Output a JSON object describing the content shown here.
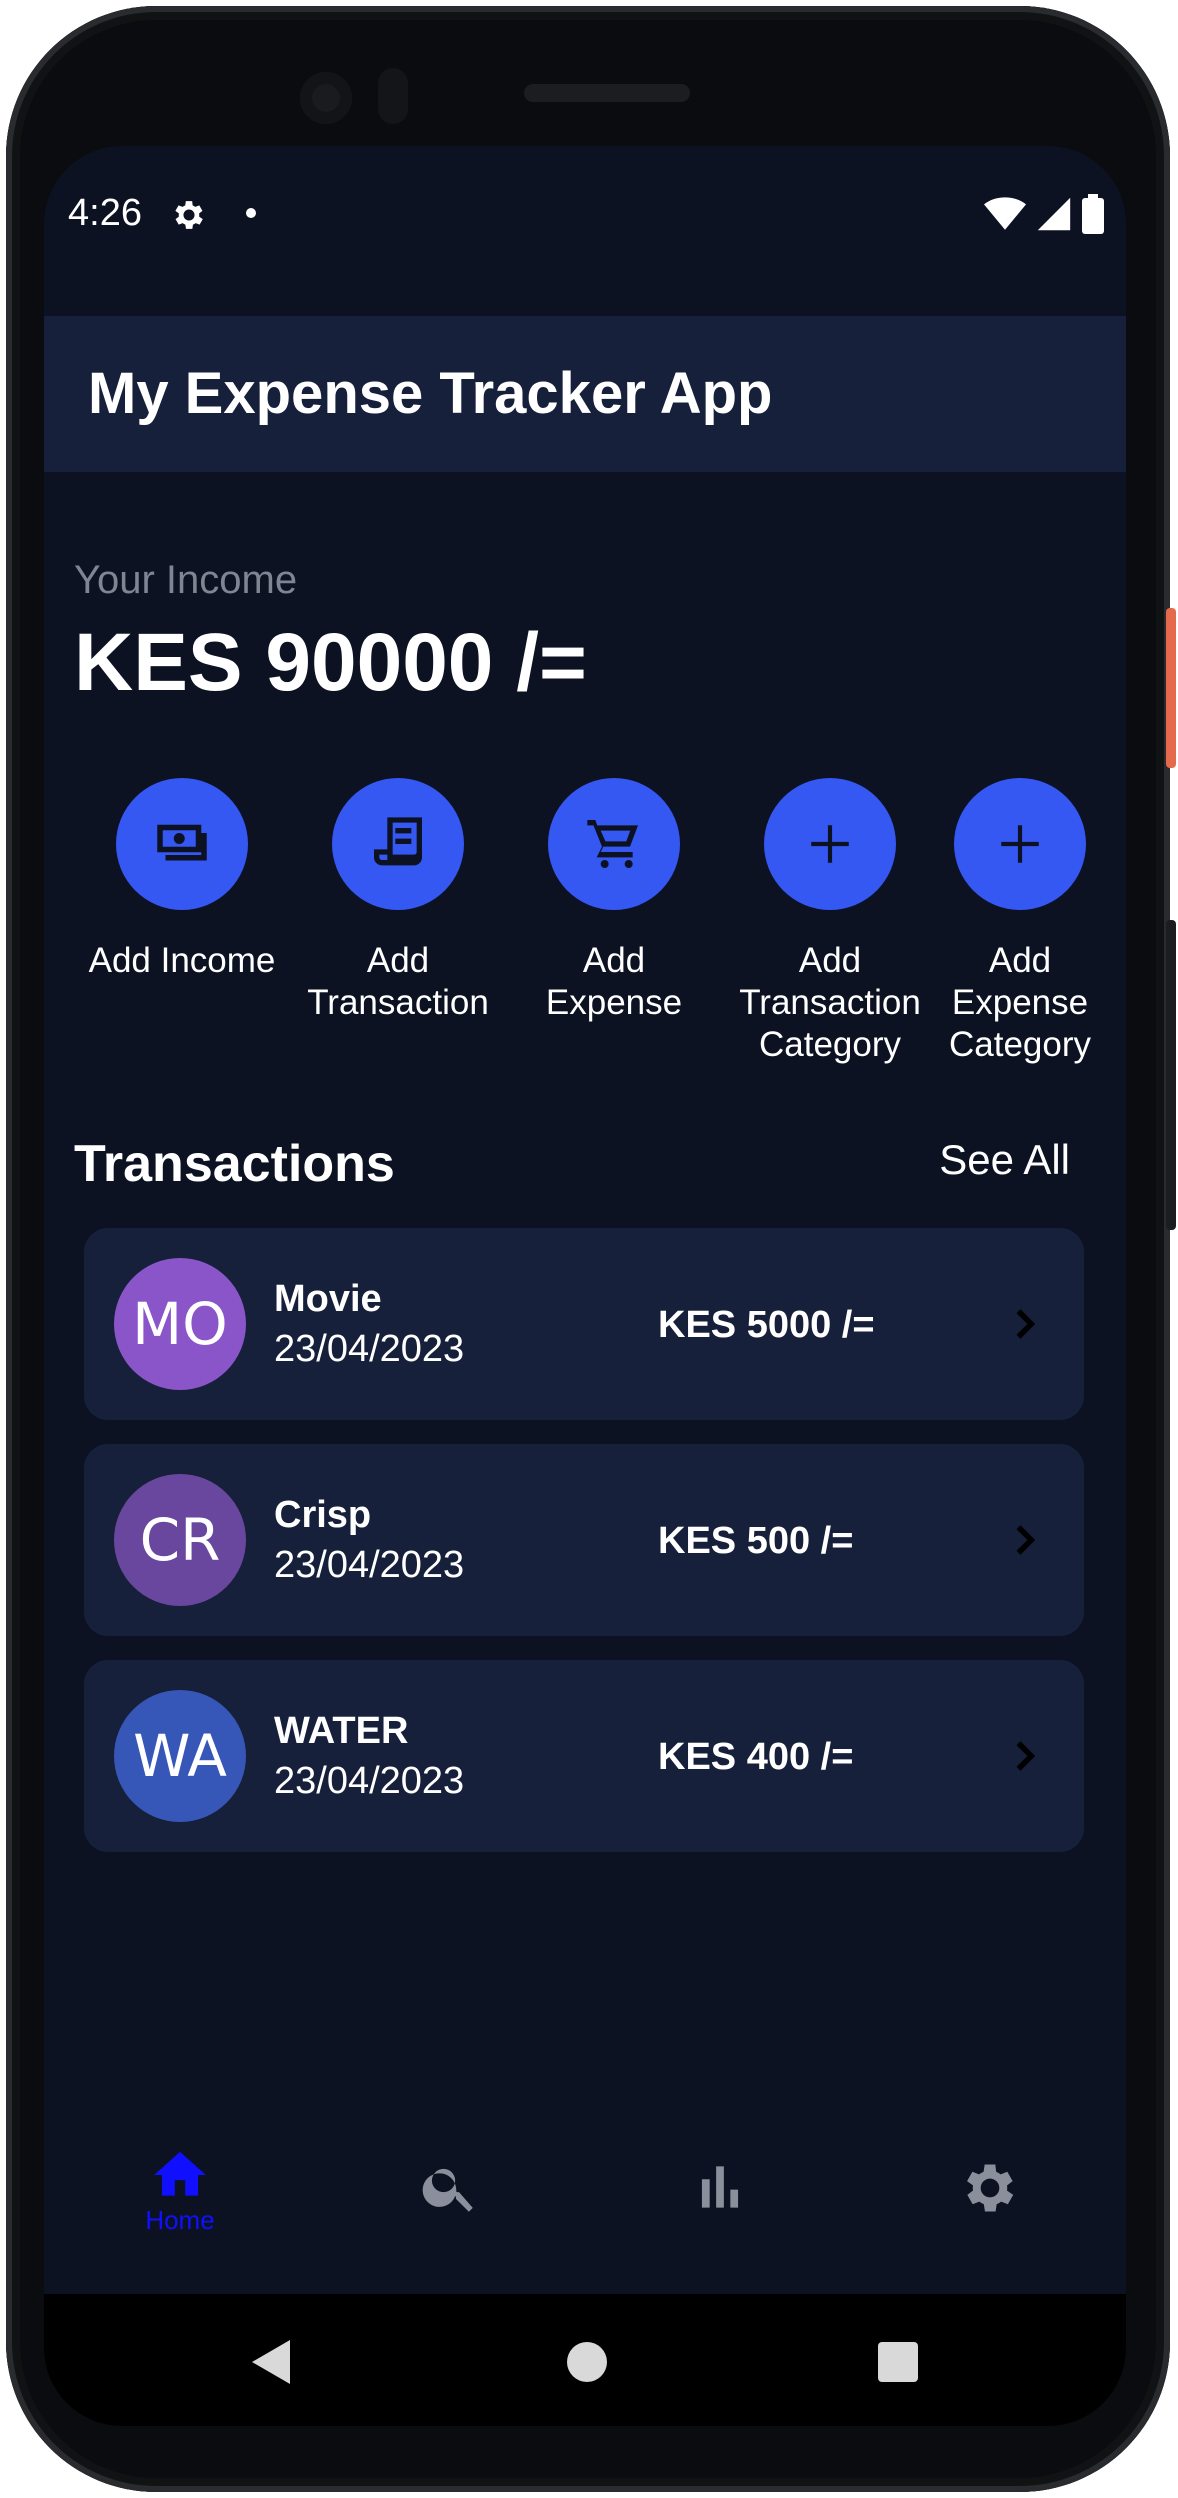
{
  "status_bar": {
    "time": "4:26"
  },
  "app_bar": {
    "title": "My Expense Tracker App"
  },
  "income": {
    "label": "Your Income",
    "value": "KES 90000 /="
  },
  "quick_actions": [
    {
      "label": "Add Income",
      "icon": "money-icon"
    },
    {
      "label": "Add Transaction",
      "icon": "receipt-icon"
    },
    {
      "label": "Add Expense",
      "icon": "cart-icon"
    },
    {
      "label": "Add Transaction Category",
      "icon": "plus-icon"
    },
    {
      "label": "Add Expense Category",
      "icon": "plus-icon"
    }
  ],
  "transactions": {
    "title": "Transactions",
    "see_all": "See All",
    "items": [
      {
        "initials": "MO",
        "name": "Movie",
        "date": "23/04/2023",
        "amount": "KES 5000 /=",
        "avatar_color": "#8a55c8"
      },
      {
        "initials": "CR",
        "name": "Crisp",
        "date": "23/04/2023",
        "amount": "KES 500 /=",
        "avatar_color": "#6a479f"
      },
      {
        "initials": "WA",
        "name": "WATER",
        "date": "23/04/2023",
        "amount": "KES 400 /=",
        "avatar_color": "#3656b8"
      }
    ]
  },
  "bottom_nav": {
    "items": [
      {
        "icon": "home-icon",
        "label": "Home",
        "active": true
      },
      {
        "icon": "search-icon",
        "active": false
      },
      {
        "icon": "bar-chart-icon",
        "active": false
      },
      {
        "icon": "gear-icon",
        "active": false
      }
    ]
  },
  "colors": {
    "background": "#0c1222",
    "app_bar": "#16203a",
    "card": "#17203a",
    "accent": "#3557f2",
    "nav_active": "#1010ff",
    "nav_inactive": "#8a8f9b"
  }
}
